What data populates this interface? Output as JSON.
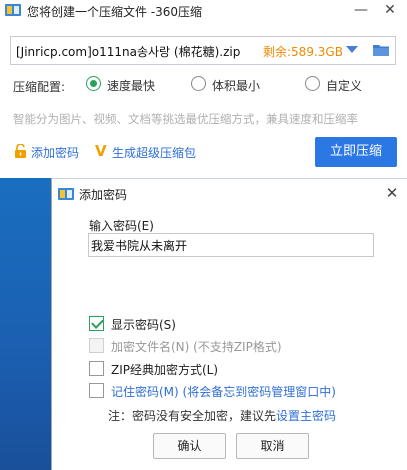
{
  "main_window": {
    "title": "您将创建一个压缩文件 -360压缩",
    "minimize_glyph": "—",
    "close_glyph": "✕",
    "path": {
      "filename": "[Jinricp.com]o111na송사랑 (棉花糖).zip",
      "free_space": "剩余:589.3GB"
    },
    "options": {
      "label": "压缩配置:",
      "radios": [
        {
          "label": "速度最快",
          "checked": true
        },
        {
          "label": "体积最小",
          "checked": false
        },
        {
          "label": "自定义",
          "checked": false
        }
      ]
    },
    "hint": "智能分为图片、视频、文档等挑选最优压缩方式，兼具速度和压缩率",
    "add_password_label": "添加密码",
    "super_pack_label": "生成超级压缩包",
    "compress_button": "立即压缩"
  },
  "password_dialog": {
    "title": "添加密码",
    "close_glyph": "✕",
    "input_label": "输入密码(E)",
    "password_value": "我爱书院从未离开",
    "checkboxes": [
      {
        "label": "显示密码(S)",
        "checked": true,
        "enabled": true
      },
      {
        "label": "加密文件名(N) (不支持ZIP格式)",
        "checked": false,
        "enabled": false
      },
      {
        "label": "ZIP经典加密方式(L)",
        "checked": false,
        "enabled": true
      },
      {
        "label": "记住密码(M) (将会备忘到密码管理窗口中)",
        "checked": false,
        "enabled": true
      }
    ],
    "note_prefix": "注：密码没有安全加密，建议先",
    "note_link": "设置主密码",
    "ok_button": "确认",
    "cancel_button": "取消"
  },
  "colors": {
    "accent_blue": "#2b78e4",
    "link_blue": "#2e6fd5",
    "check_green": "#2ca05a",
    "free_space_orange": "#f08a00",
    "desktop_blue": "#1b5fb0"
  },
  "icons": {
    "app": "zip-archive-icon",
    "folder": "folder-icon",
    "lock": "lock-open-icon",
    "super": "v-badge-icon"
  }
}
